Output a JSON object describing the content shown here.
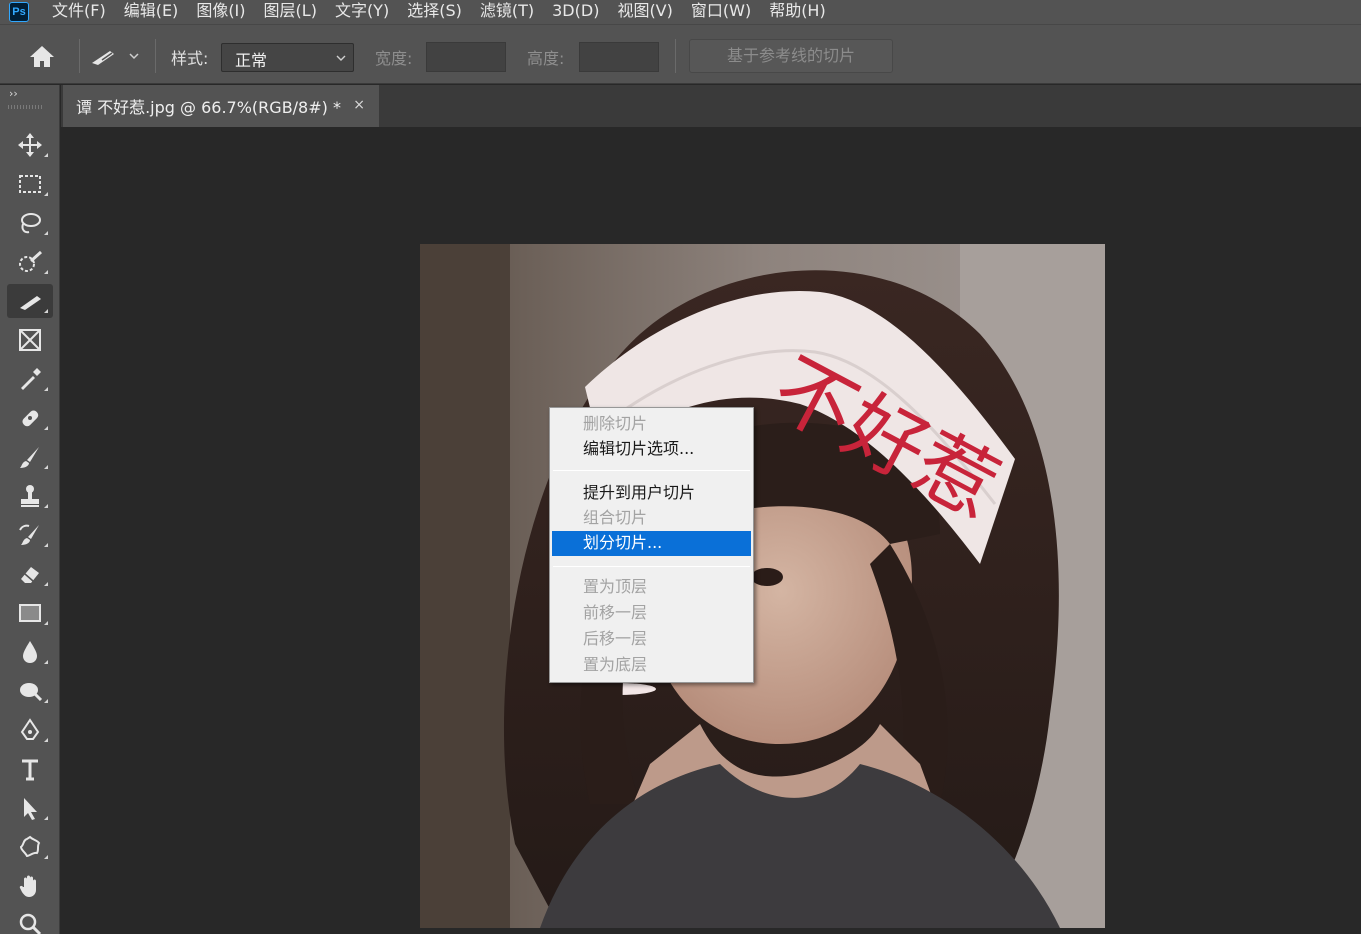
{
  "app": {
    "logo": "Ps"
  },
  "menubar": {
    "items": [
      "文件(F)",
      "编辑(E)",
      "图像(I)",
      "图层(L)",
      "文字(Y)",
      "选择(S)",
      "滤镜(T)",
      "3D(D)",
      "视图(V)",
      "窗口(W)",
      "帮助(H)"
    ]
  },
  "options": {
    "home_icon": "home-icon",
    "tool_icon": "slice-tool-icon",
    "style_label": "样式:",
    "style_value": "正常",
    "width_label": "宽度:",
    "height_label": "高度:",
    "guides_button": "基于参考线的切片"
  },
  "document": {
    "tab_title": "谭 不好惹.jpg @ 66.7%(RGB/8#) *",
    "close": "×"
  },
  "toolbar": {
    "collapse": "››",
    "tools": [
      {
        "name": "move-tool-icon"
      },
      {
        "name": "marquee-tool-icon"
      },
      {
        "name": "lasso-tool-icon"
      },
      {
        "name": "quick-selection-tool-icon"
      },
      {
        "name": "slice-tool-icon",
        "active": true
      },
      {
        "name": "frame-tool-icon"
      },
      {
        "name": "eyedropper-tool-icon"
      },
      {
        "name": "healing-brush-tool-icon"
      },
      {
        "name": "brush-tool-icon"
      },
      {
        "name": "clone-stamp-tool-icon"
      },
      {
        "name": "history-brush-tool-icon"
      },
      {
        "name": "eraser-tool-icon"
      },
      {
        "name": "gradient-tool-icon"
      },
      {
        "name": "blur-tool-icon"
      },
      {
        "name": "dodge-tool-icon"
      },
      {
        "name": "pen-tool-icon"
      },
      {
        "name": "type-tool-icon"
      },
      {
        "name": "path-selection-tool-icon"
      },
      {
        "name": "custom-shape-tool-icon"
      },
      {
        "name": "hand-tool-icon"
      },
      {
        "name": "zoom-tool-icon"
      }
    ]
  },
  "context_menu": {
    "groups": [
      [
        {
          "label": "删除切片",
          "state": "disabled"
        },
        {
          "label": "编辑切片选项...",
          "state": "enabled"
        }
      ],
      [
        {
          "label": "提升到用户切片",
          "state": "enabled"
        },
        {
          "label": "组合切片",
          "state": "disabled"
        },
        {
          "label": "划分切片...",
          "state": "highlight"
        }
      ],
      [
        {
          "label": "置为顶层",
          "state": "disabled"
        },
        {
          "label": "前移一层",
          "state": "disabled"
        },
        {
          "label": "后移一层",
          "state": "disabled"
        },
        {
          "label": "置为底层",
          "state": "disabled"
        }
      ]
    ]
  },
  "photo": {
    "headband_text": "不好惹"
  },
  "colors": {
    "highlight": "#0a70d8",
    "ps_blue": "#31a8ff",
    "headband_text": "#c8243a"
  }
}
